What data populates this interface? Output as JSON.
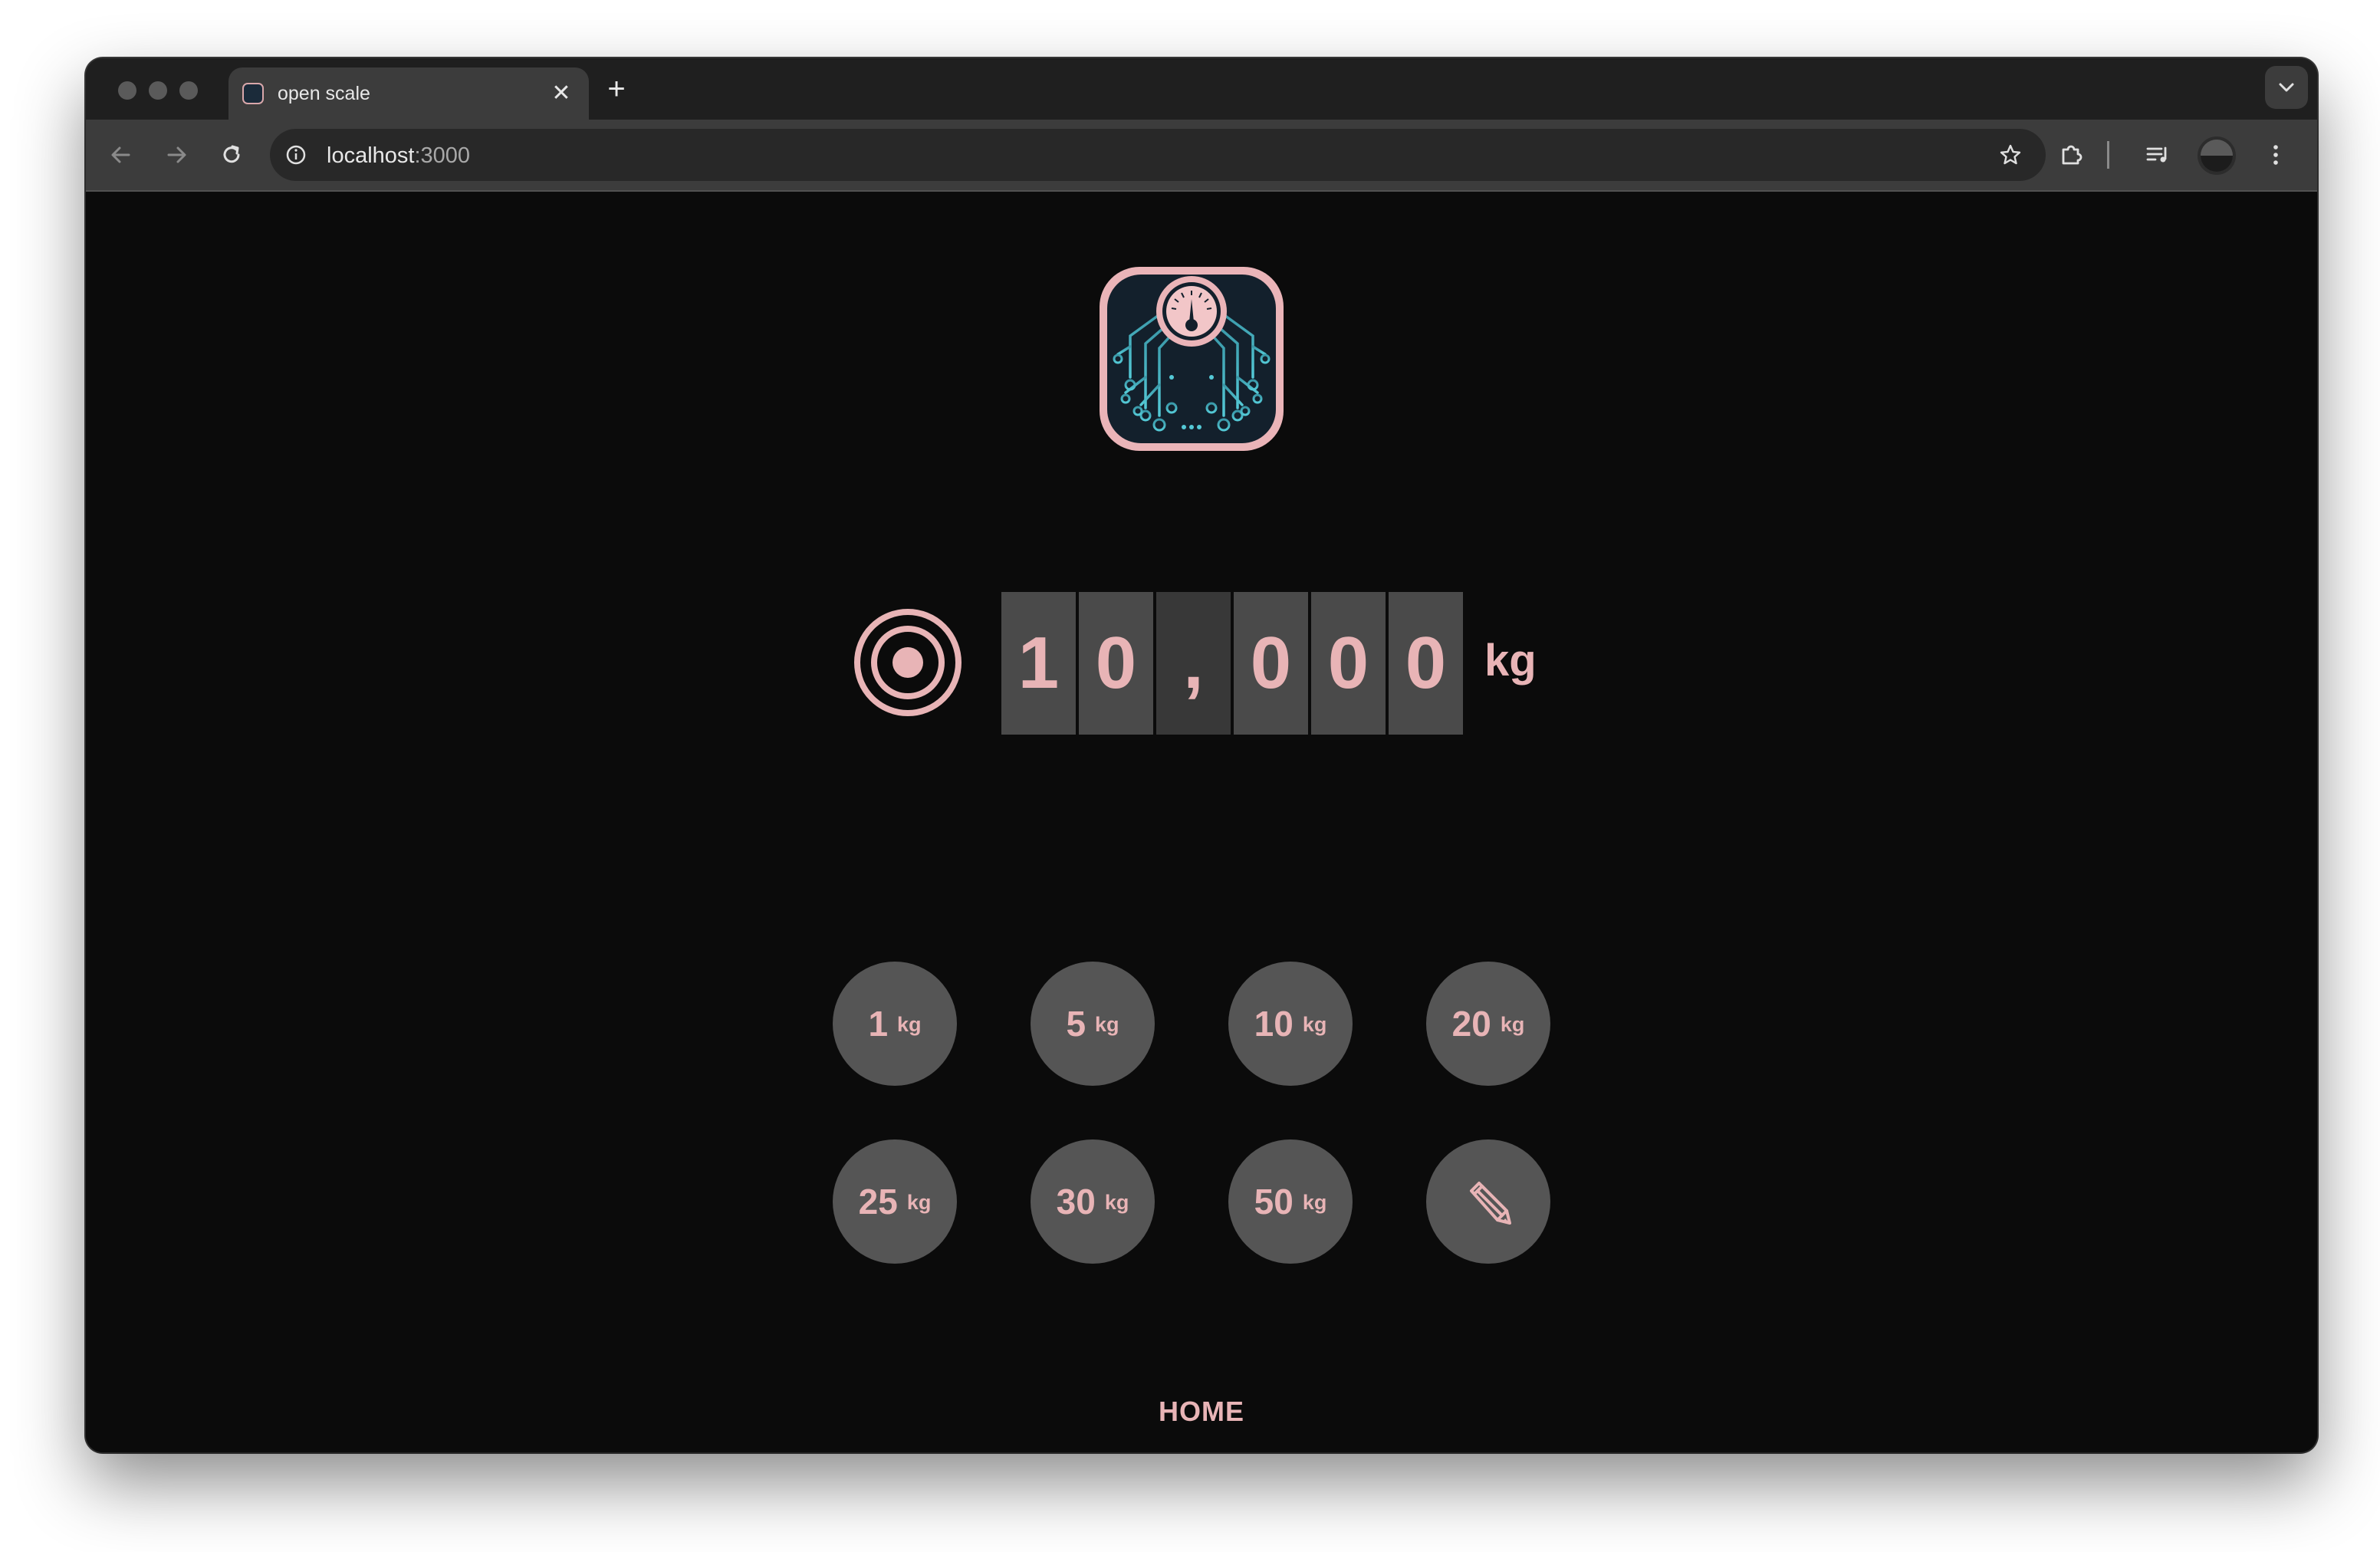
{
  "browser": {
    "tab_title": "open scale",
    "tab_close_glyph": "✕",
    "new_tab_glyph": "+",
    "url_host": "localhost",
    "url_port": ":3000",
    "icons": [
      "back-icon",
      "forward-icon",
      "reload-icon",
      "site-info-icon",
      "bookmark-star-icon",
      "extensions-icon",
      "media-controls-icon",
      "profile-avatar",
      "menu-icon",
      "tab-search-icon"
    ]
  },
  "app": {
    "target_icon": "target-icon",
    "display": {
      "value": 10000,
      "digits": [
        "1",
        "0",
        ",",
        "0",
        "0",
        "0"
      ],
      "unit": "kg"
    },
    "presets": [
      {
        "value": "1",
        "unit": "kg"
      },
      {
        "value": "5",
        "unit": "kg"
      },
      {
        "value": "10",
        "unit": "kg"
      },
      {
        "value": "20",
        "unit": "kg"
      },
      {
        "value": "25",
        "unit": "kg"
      },
      {
        "value": "30",
        "unit": "kg"
      },
      {
        "value": "50",
        "unit": "kg"
      }
    ],
    "edit_icon": "pencil-icon",
    "nav_home": "HOME"
  },
  "colors": {
    "accent_pink": "#e8b4b6",
    "page_bg": "#0b0b0b",
    "button_bg": "#555555",
    "digit_bg": "#4a4a4a",
    "separator_bg": "#383838",
    "logo_teal": "#4fc4d0"
  }
}
